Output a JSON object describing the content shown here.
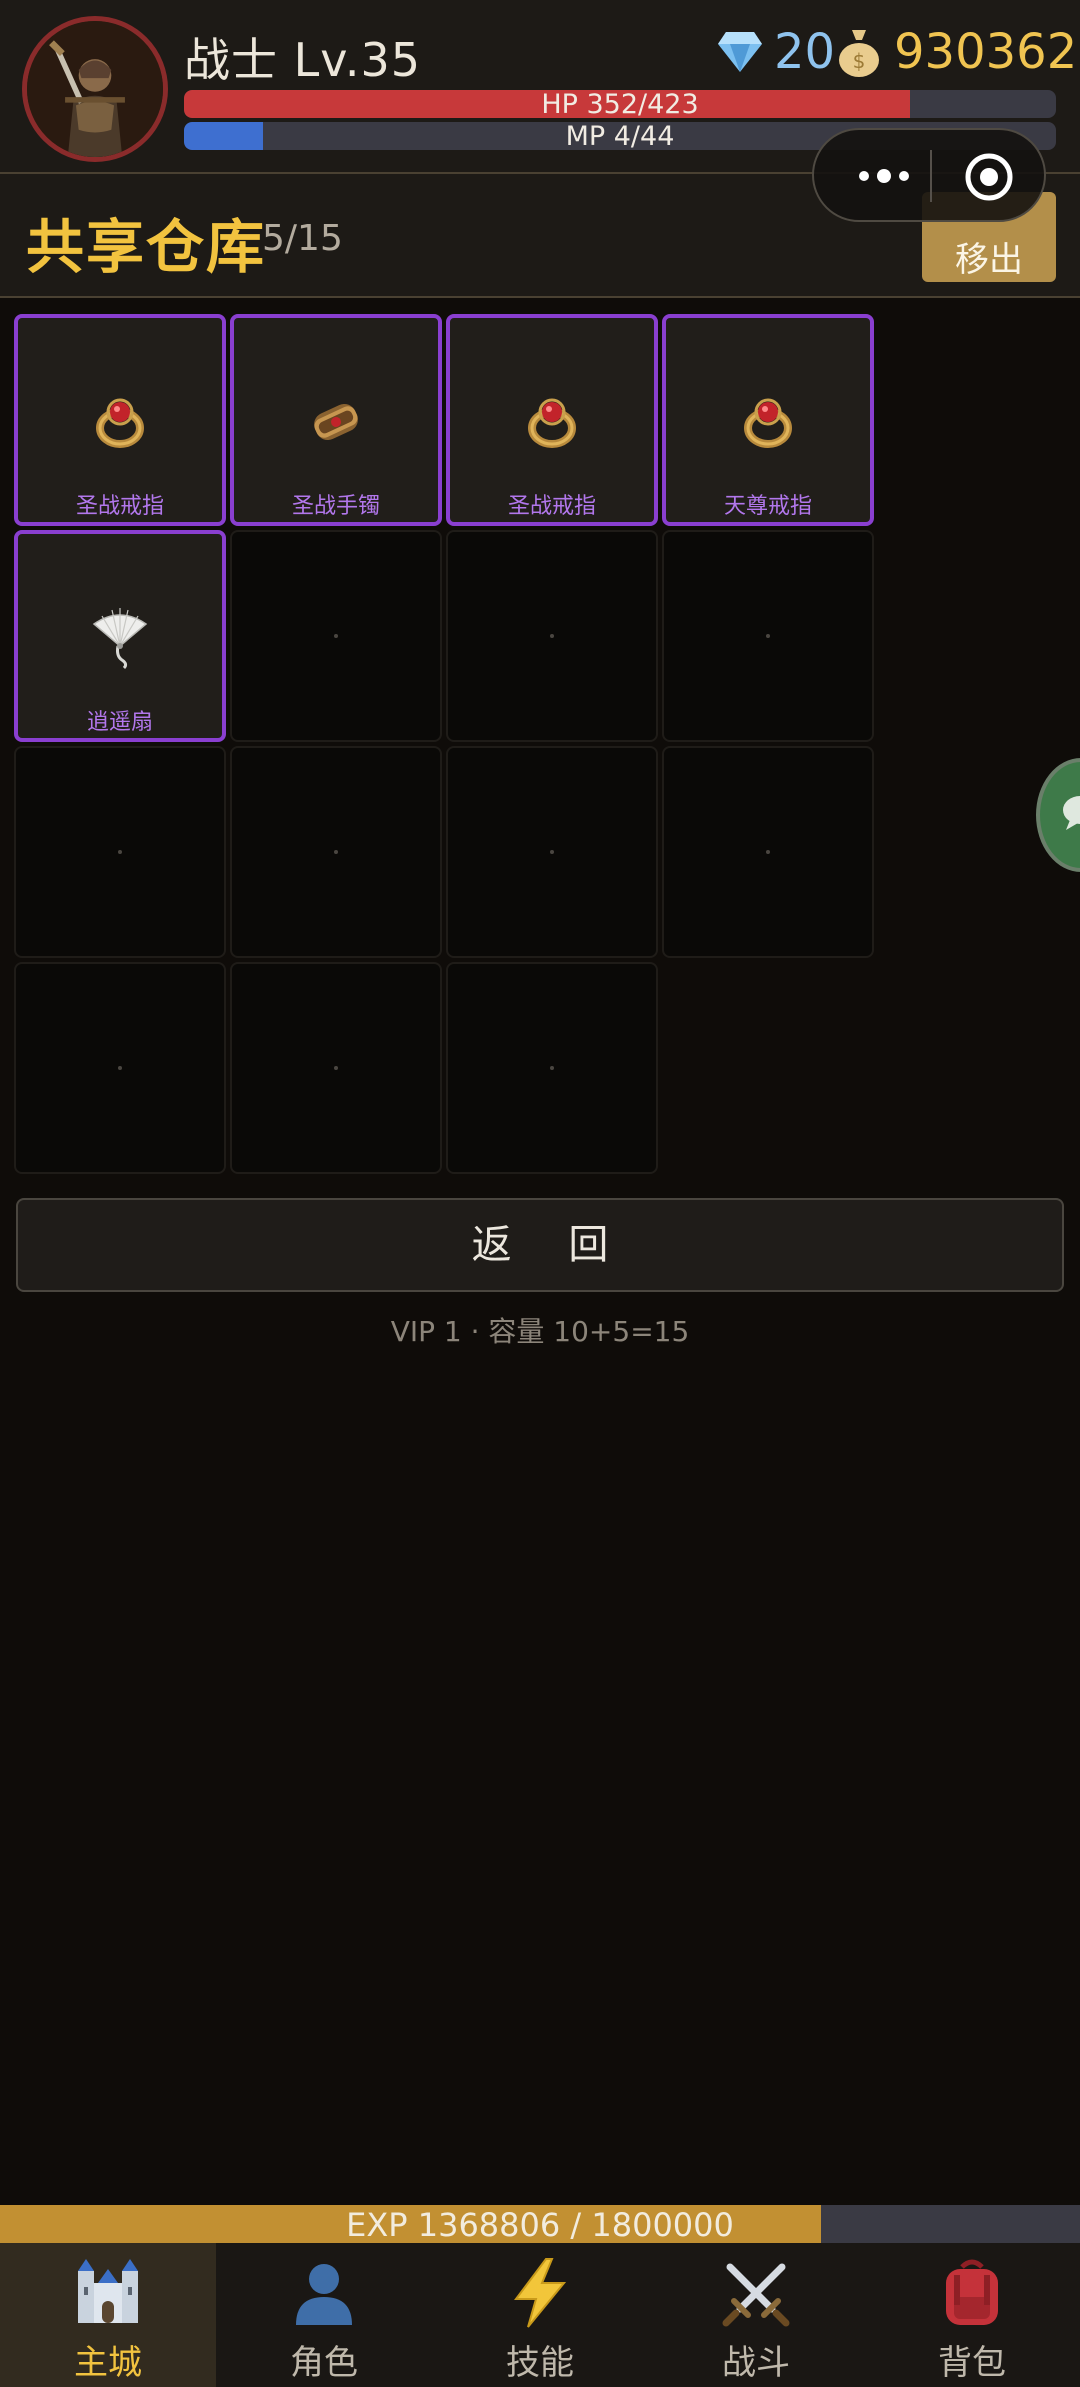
{
  "header": {
    "player_name": "战士 Lv.35",
    "gems": "20",
    "gold": "930362",
    "hp_label": "HP 352/423",
    "hp_fraction": 0.832,
    "mp_label": "MP 4/44",
    "mp_fraction": 0.091
  },
  "section": {
    "title": "共享仓库",
    "count": "5/15",
    "remove_label": "移出"
  },
  "slots": [
    {
      "name": "圣战戒指",
      "icon": "ring-icon"
    },
    {
      "name": "圣战手镯",
      "icon": "bracelet-icon"
    },
    {
      "name": "圣战戒指",
      "icon": "ring-icon"
    },
    {
      "name": "天尊戒指",
      "icon": "ring-icon"
    },
    {
      "name": "逍遥扇",
      "icon": "fan-icon"
    },
    null,
    null,
    null,
    null,
    null,
    null,
    null,
    null,
    null,
    null
  ],
  "return_label": "返 回",
  "vip_info": "VIP 1 · 容量 10+5=15",
  "exp": {
    "label": "EXP  1368806 / 1800000",
    "fraction": 0.76
  },
  "tabs": [
    {
      "label": "主城",
      "icon": "castle-icon",
      "active": true
    },
    {
      "label": "角色",
      "icon": "person-icon",
      "active": false
    },
    {
      "label": "技能",
      "icon": "lightning-icon",
      "active": false
    },
    {
      "label": "战斗",
      "icon": "crossed-swords-icon",
      "active": false
    },
    {
      "label": "背包",
      "icon": "backpack-icon",
      "active": false
    }
  ],
  "colors": {
    "accent_gold": "#f2c33f",
    "item_purple": "#8a3fd0",
    "hp": "#c7393a",
    "mp": "#3e6fd0",
    "exp": "#c29032"
  }
}
